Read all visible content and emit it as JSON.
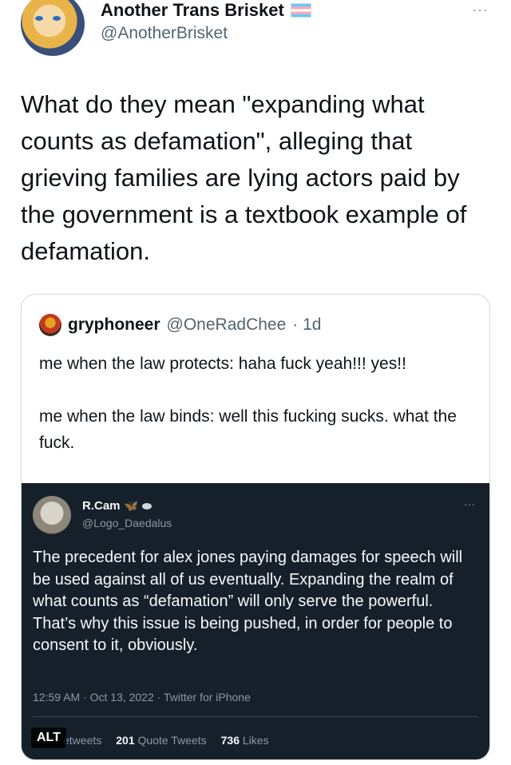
{
  "author": {
    "name": "Another Trans Brisket",
    "handle": "@AnotherBrisket"
  },
  "tweet": {
    "text": "What do they mean \"expanding what counts as defamation\", alleging that grieving families are lying actors paid by the government is a textbook example of defamation."
  },
  "more_menu": "···",
  "quote": {
    "name": "gryphoneer",
    "handle": "@OneRadChee",
    "meta": "· 1d",
    "paragraphs": [
      "me when the law protects: haha fuck yeah!!! yes!!",
      "me when the law binds: well this fucking sucks. what the fuck."
    ]
  },
  "embedded": {
    "name": "R.Cam",
    "handle": "@Logo_Daedalus",
    "more": "···",
    "text": "The precedent for alex jones paying damages for speech will be used against all of us eventually. Expanding the realm of what counts as “defamation” will only serve the powerful. That’s why this issue is being pushed, in order for people to consent to it, obviously.",
    "timestamp": "12:59 AM · Oct 13, 2022 · Twitter for iPhone",
    "stats": {
      "retweets_label": "etweets",
      "quote_tweets_count": "201",
      "quote_tweets_label": "Quote Tweets",
      "likes_count": "736",
      "likes_label": "Likes"
    },
    "alt_badge": "ALT"
  },
  "colors": {
    "text": "#0f1419",
    "muted": "#536471",
    "dark_bg": "#15202b"
  }
}
